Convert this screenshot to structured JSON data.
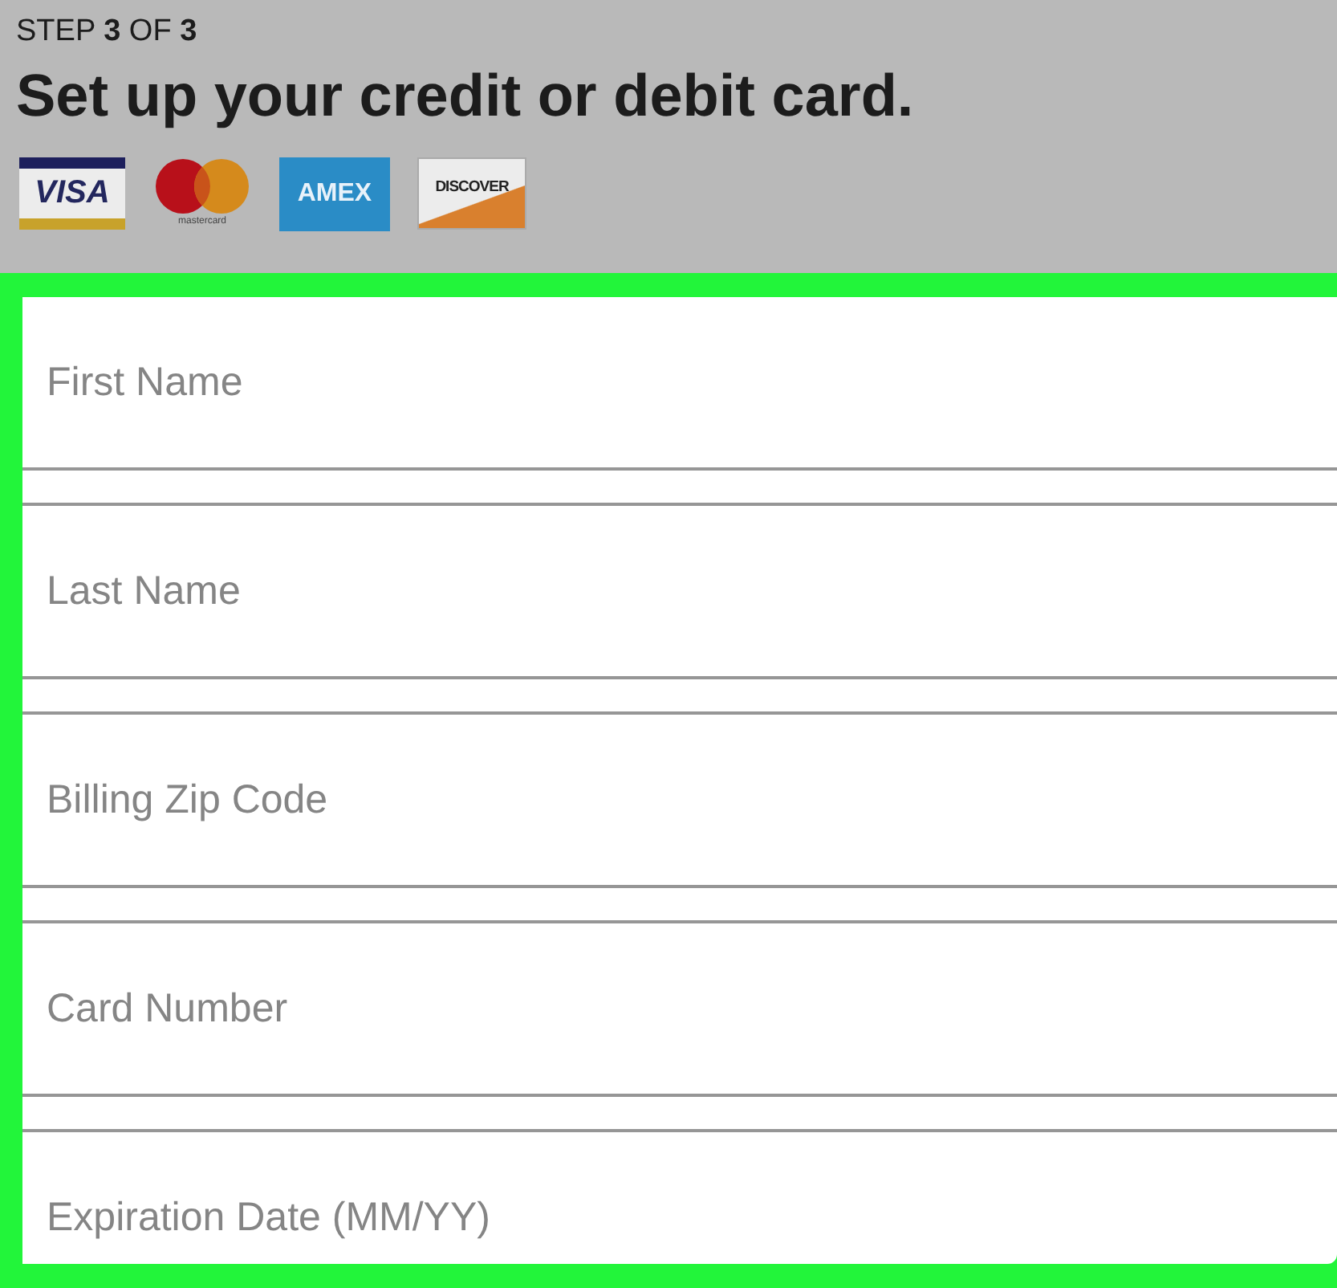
{
  "step": "STEP **3** OF **3**",
  "title": "Set up your credit or debit card.",
  "card_logos": [
    {
      "kind": "visa",
      "label": "VISA"
    },
    {
      "kind": "mastercard",
      "label": "mastercard"
    },
    {
      "kind": "amex",
      "label": "AMEX"
    },
    {
      "kind": "discover",
      "label": "DISCOVER"
    }
  ],
  "fields": [
    {
      "placeholder": "First Name"
    },
    {
      "placeholder": "Last Name"
    },
    {
      "placeholder": "Billing Zip Code"
    },
    {
      "placeholder": "Card Number"
    },
    {
      "placeholder": "Expiration Date (MM/YY)"
    }
  ]
}
